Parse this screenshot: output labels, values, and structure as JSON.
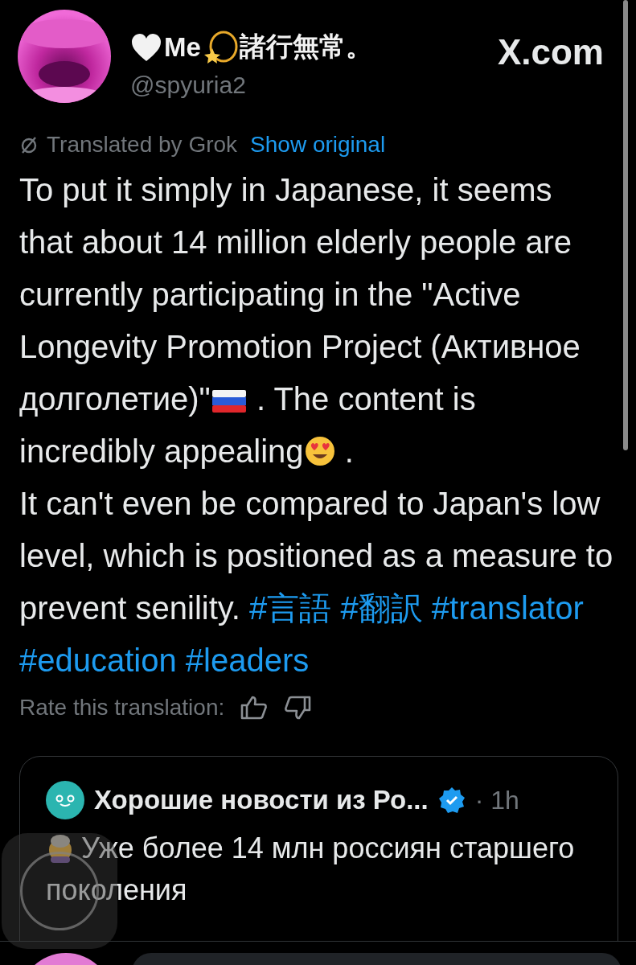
{
  "author": {
    "display_name": "Me",
    "name_suffix": "諸行無常。",
    "handle": "@spyuria2"
  },
  "site_label": "X.com",
  "translation": {
    "label": "Translated by Grok",
    "link": "Show original"
  },
  "body": [
    {
      "kind": "text",
      "text": "To put it simply in Japanese, it seems that about 14 million elderly people are currently participating in the \"Active Longevity Promotion Project (Активное долголетие)\""
    },
    {
      "kind": "flag"
    },
    {
      "kind": "text",
      "text": " . The content is incredibly appealing"
    },
    {
      "kind": "heart-eyes"
    },
    {
      "kind": "text",
      "text": " .\nIt can't even be compared to Japan's low level, which is positioned as a measure to prevent senility. "
    },
    {
      "kind": "hashtag",
      "text": "#言語"
    },
    {
      "kind": "hashtag",
      "text": "#翻訳"
    },
    {
      "kind": "hashtag",
      "text": "#translator"
    },
    {
      "kind": "hashtag",
      "text": "#education"
    },
    {
      "kind": "hashtag",
      "text": "#leaders"
    }
  ],
  "rating": {
    "label": "Rate this translation:"
  },
  "quote": {
    "author": "Хорошие новости из Ро...",
    "verified": true,
    "time": "· 1h",
    "text": "Уже более 14 млн россиян старшего поколения"
  }
}
